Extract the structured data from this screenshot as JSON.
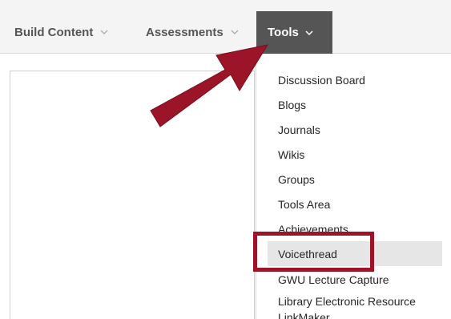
{
  "menubar": {
    "items": [
      {
        "label": "Build Content",
        "state": "normal"
      },
      {
        "label": "Assessments",
        "state": "normal"
      },
      {
        "label": "Tools",
        "state": "open"
      }
    ]
  },
  "dropdown": {
    "items": [
      {
        "label": "Discussion Board"
      },
      {
        "label": "Blogs"
      },
      {
        "label": "Journals"
      },
      {
        "label": "Wikis"
      },
      {
        "label": "Groups"
      },
      {
        "label": "Tools Area"
      },
      {
        "label": "Achievements"
      },
      {
        "label": "Voicethread",
        "highlighted": true
      },
      {
        "label": "GWU Lecture Capture"
      },
      {
        "label": "Library Electronic Resource LinkMaker"
      }
    ]
  },
  "annotation": {
    "color": "#9b1428",
    "arrow_target": "Tools",
    "box_target": "Voicethread"
  },
  "colors": {
    "menubar_bg": "#f4f4f4",
    "active_menu_bg": "#555555",
    "hover_item_bg": "#e6e6e6"
  }
}
